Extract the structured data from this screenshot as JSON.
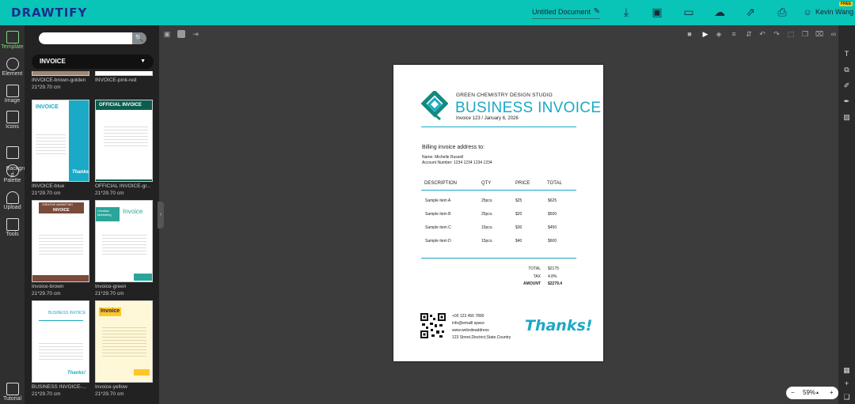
{
  "app": {
    "logo": "DRAWTIFY",
    "doc_title": "Untitled Document",
    "user": "Kevin Wang",
    "free_badge": "FREE"
  },
  "leftrail": {
    "items": [
      {
        "label": "Template"
      },
      {
        "label": "Element"
      },
      {
        "label": "Image"
      },
      {
        "label": "Icons"
      },
      {
        "label": "Backgrou\nd"
      },
      {
        "label": "Palette"
      },
      {
        "label": "Upload"
      },
      {
        "label": "Tools"
      },
      {
        "label": "Tutorial"
      }
    ]
  },
  "panel": {
    "search_placeholder": "",
    "category": "INVOICE",
    "thumbs": [
      {
        "name": "INVOICE-brown-golden",
        "size": "21*29.70 cm"
      },
      {
        "name": "INVOICE-pink-red",
        "size": ""
      },
      {
        "name": "INVOICE-blue",
        "size": "21*29.70 cm"
      },
      {
        "name": "OFFICIAL INVOICE-gr...",
        "size": "21*29.70 cm"
      },
      {
        "name": "Invoice-brown",
        "size": "21*29.70 cm"
      },
      {
        "name": "Invoice-green",
        "size": "21*29.70 cm"
      },
      {
        "name": "BUSINESS INVOICE-...",
        "size": "21*29.70 cm"
      },
      {
        "name": "Invoice-yellow",
        "size": "21*29.70 cm"
      }
    ],
    "thumb_texts": {
      "blue_title": "INVOICE",
      "official_title": "OFFICIAL INVOICE",
      "brown_banner": "CREATIVE MARKETING",
      "brown_title": "INVOICE",
      "green_title": "Invoice",
      "green_brand": "Creative Marketing",
      "biz_title": "BUSINESS INVOICE",
      "yellow_title": "Invoice",
      "thanks": "Thanks!"
    }
  },
  "invoice": {
    "studio": "GREEN CHEMISTRY DESIGN STUDIO",
    "title": "BUSINESS INVOICE",
    "number": "Invoice 123 / January 6, 2026",
    "billing_heading": "Billing invoice address to:",
    "name_line": "Name: Michelle Russell",
    "account_line": "Account Number: 1234 1234 1234 1234",
    "headers": [
      "DESCRIPTION",
      "QTY",
      "PRICE",
      "TOTAL"
    ],
    "rows": [
      {
        "desc": "Sample item A",
        "qty": "25pcs.",
        "price": "$25",
        "total": "$625"
      },
      {
        "desc": "Sample item B",
        "qty": "25pcs.",
        "price": "$20",
        "total": "$500"
      },
      {
        "desc": "Sample item C",
        "qty": "15pcs.",
        "price": "$30",
        "total": "$450"
      },
      {
        "desc": "Sample item D",
        "qty": "15pcs.",
        "price": "$40",
        "total": "$600"
      }
    ],
    "totals": [
      {
        "label": "TOTAL",
        "value": "$2175"
      },
      {
        "label": "TAX",
        "value": "4.8%"
      },
      {
        "label": "AMOUNT",
        "value": "$2279.4"
      }
    ],
    "phone": "+00 123 456 7890",
    "email": "info@emaill space",
    "web": "www.websiteaddress",
    "address": "123 Street,Disctrict,State,Country",
    "thanks": "Thanks!"
  },
  "zoom": {
    "minus": "−",
    "value": "59%",
    "caret": "▴",
    "plus": "+"
  },
  "colors": {
    "brand": "#08c5b8",
    "accent": "#1aa9c6"
  }
}
